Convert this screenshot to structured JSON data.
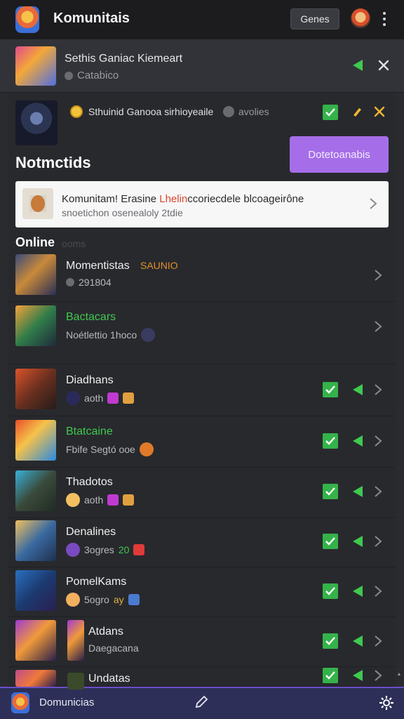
{
  "header": {
    "title": "Komunitais",
    "games_button": "Genes"
  },
  "now_playing": {
    "title": "Sethis Ganiac Kiemeart",
    "subtitle": "Catabico"
  },
  "featured": {
    "text": "Sthuinid Ganooa sirhioyeaile",
    "status": "avolies"
  },
  "section": {
    "title": "Notmctids",
    "button": "Dotetoanabis"
  },
  "notification": {
    "line1_prefix": "Komunitam! Erasine ",
    "line1_highlight": "Lhelin",
    "line1_suffix": "ccoriecdele blcoageirône",
    "line2": "snoetichon osenealoly 2tdie"
  },
  "online": {
    "label": "Online",
    "count": "ooms"
  },
  "friends": [
    {
      "name": "Momentistas",
      "name_color": "#f0f0f0",
      "tag": "SAUNIO",
      "sub": "291804",
      "has_actions": false
    },
    {
      "name": "Bactacars",
      "name_color": "#3fc94f",
      "sub": "Noétlettio 1hoco",
      "has_actions": false
    },
    {
      "name": "Diadhans",
      "name_color": "#f0f0f0",
      "sub": "aoth",
      "has_actions": true
    },
    {
      "name": "Btatcaine",
      "name_color": "#3fc94f",
      "sub": "Fbife Segtó ooe",
      "has_actions": true
    },
    {
      "name": "Thadotos",
      "name_color": "#f0f0f0",
      "sub": "aoth",
      "has_actions": true
    },
    {
      "name": "Denalines",
      "name_color": "#f0f0f0",
      "sub": "3ogres",
      "sub_tag": "20",
      "has_actions": true
    },
    {
      "name": "PomelKams",
      "name_color": "#f0f0f0",
      "sub": "5ogro",
      "sub_tag": "ay",
      "has_actions": true
    },
    {
      "name": "Atdans",
      "name_color": "#f0f0f0",
      "sub": "Daegacana",
      "has_actions": true
    },
    {
      "name": "Undatas",
      "name_color": "#f0f0f0",
      "sub": "",
      "has_actions": true
    }
  ],
  "bottom_bar": {
    "title": "Domunicias"
  },
  "colors": {
    "accent_purple": "#a56ee8",
    "online_green": "#35b24a",
    "warning_yellow": "#f2b830"
  }
}
